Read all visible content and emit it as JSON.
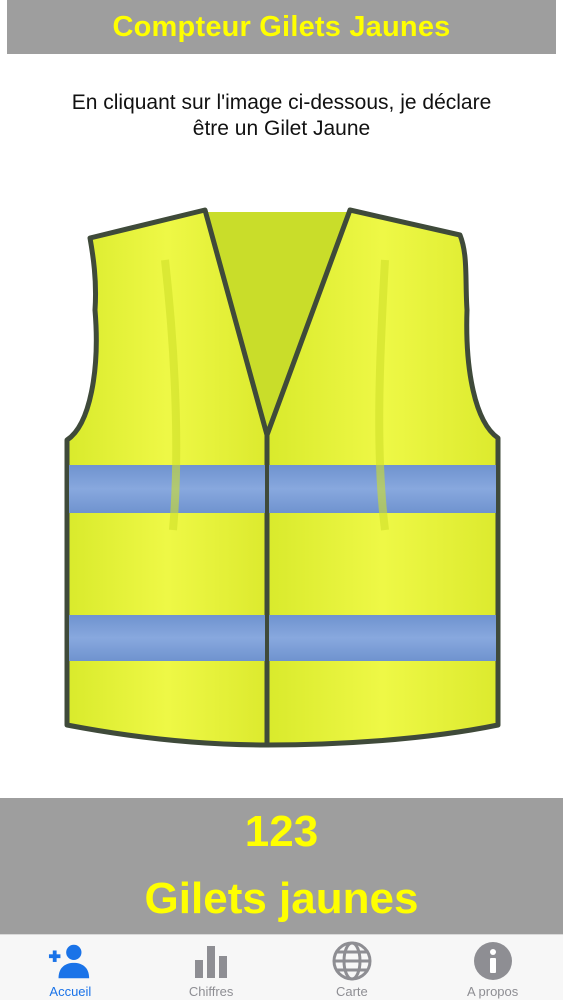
{
  "header": {
    "title": "Compteur Gilets Jaunes"
  },
  "main": {
    "instruction_line1": "En cliquant sur l'image ci-dessous, je déclare",
    "instruction_line2": "être un Gilet Jaune",
    "vest_image": "yellow-safety-vest-icon"
  },
  "counter": {
    "value": "123",
    "label": "Gilets jaunes"
  },
  "tabs": [
    {
      "label": "Accueil",
      "icon": "add-user-icon",
      "active": true
    },
    {
      "label": "Chiffres",
      "icon": "bar-chart-icon",
      "active": false
    },
    {
      "label": "Carte",
      "icon": "globe-icon",
      "active": false
    },
    {
      "label": "A propos",
      "icon": "info-icon",
      "active": false
    }
  ],
  "colors": {
    "header_bg": "#9e9e9e",
    "accent_yellow": "#ffff00",
    "active_tab": "#1a73e8",
    "inactive_tab": "#8e8e93",
    "vest_yellow": "#e8f53a",
    "reflective_band": "#7e9fd6"
  }
}
